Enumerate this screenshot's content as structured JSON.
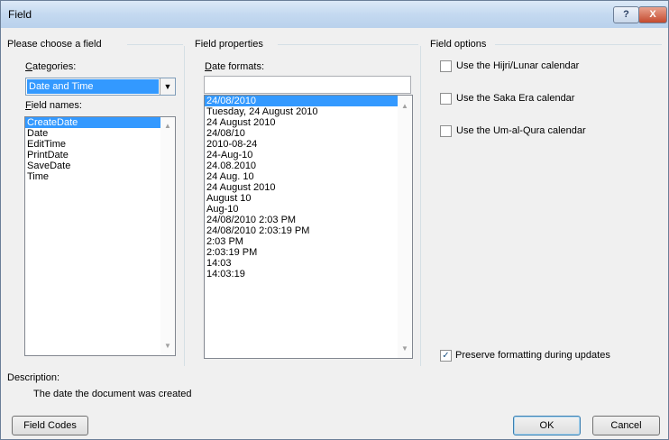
{
  "dialog": {
    "title": "Field",
    "help_glyph": "?",
    "close_glyph": "X"
  },
  "choose": {
    "group_label": "Please choose a field",
    "categories_label": "Categories:",
    "category_value": "Date and Time",
    "field_names_label": "Field names:",
    "field_names": [
      "CreateDate",
      "Date",
      "EditTime",
      "PrintDate",
      "SaveDate",
      "Time"
    ],
    "selected_index": 0
  },
  "properties": {
    "group_label": "Field properties",
    "date_formats_label": "Date formats:",
    "date_format_value": "",
    "formats": [
      "24/08/2010",
      "Tuesday, 24 August 2010",
      "24 August 2010",
      "24/08/10",
      "2010-08-24",
      "24-Aug-10",
      "24.08.2010",
      "24 Aug. 10",
      "24 August 2010",
      "August 10",
      "Aug-10",
      "24/08/2010 2:03 PM",
      "24/08/2010 2:03:19 PM",
      "2:03 PM",
      "2:03:19 PM",
      "14:03",
      "14:03:19"
    ],
    "selected_index": 0
  },
  "options": {
    "group_label": "Field options",
    "hijri": "Use the Hijri/Lunar calendar",
    "saka": "Use the Saka Era calendar",
    "umalqura": "Use the Um-al-Qura calendar",
    "preserve": "Preserve formatting during updates",
    "preserve_checked": true
  },
  "description": {
    "label": "Description:",
    "text": "The date the document was created"
  },
  "buttons": {
    "field_codes": "Field Codes",
    "ok": "OK",
    "cancel": "Cancel"
  },
  "glyphs": {
    "scroll_up": "▲",
    "scroll_down": "▼",
    "combo_down": "▼",
    "check": "✓"
  }
}
